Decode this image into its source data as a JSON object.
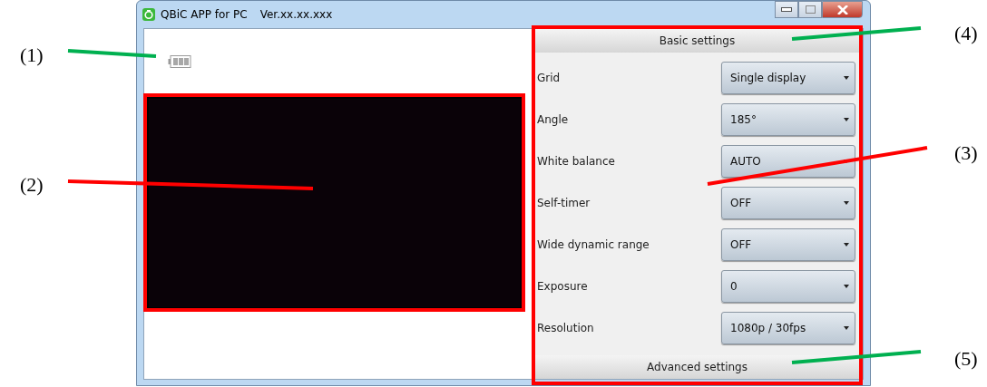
{
  "window": {
    "title": "QBiC APP for PC",
    "version": "Ver.xx.xx.xxx"
  },
  "basic_settings": {
    "title": "Basic settings",
    "settings": [
      {
        "label": "Grid",
        "value": "Single display"
      },
      {
        "label": "Angle",
        "value": "185°"
      },
      {
        "label": "White balance",
        "value": "AUTO"
      },
      {
        "label": "Self-timer",
        "value": "OFF"
      },
      {
        "label": "Wide dynamic range",
        "value": "OFF"
      },
      {
        "label": "Exposure",
        "value": "0"
      },
      {
        "label": "Resolution",
        "value": "1080p / 30fps"
      }
    ]
  },
  "advanced_settings": {
    "title": "Advanced settings"
  },
  "annotations": [
    {
      "label": "(4)",
      "color": "#00b050"
    },
    {
      "label": "(1)",
      "color": "#00b050"
    },
    {
      "label": "(3)",
      "color": "#ff0000"
    },
    {
      "label": "(2)",
      "color": "#ff0000"
    },
    {
      "label": "(5)",
      "color": "#00b050"
    }
  ]
}
